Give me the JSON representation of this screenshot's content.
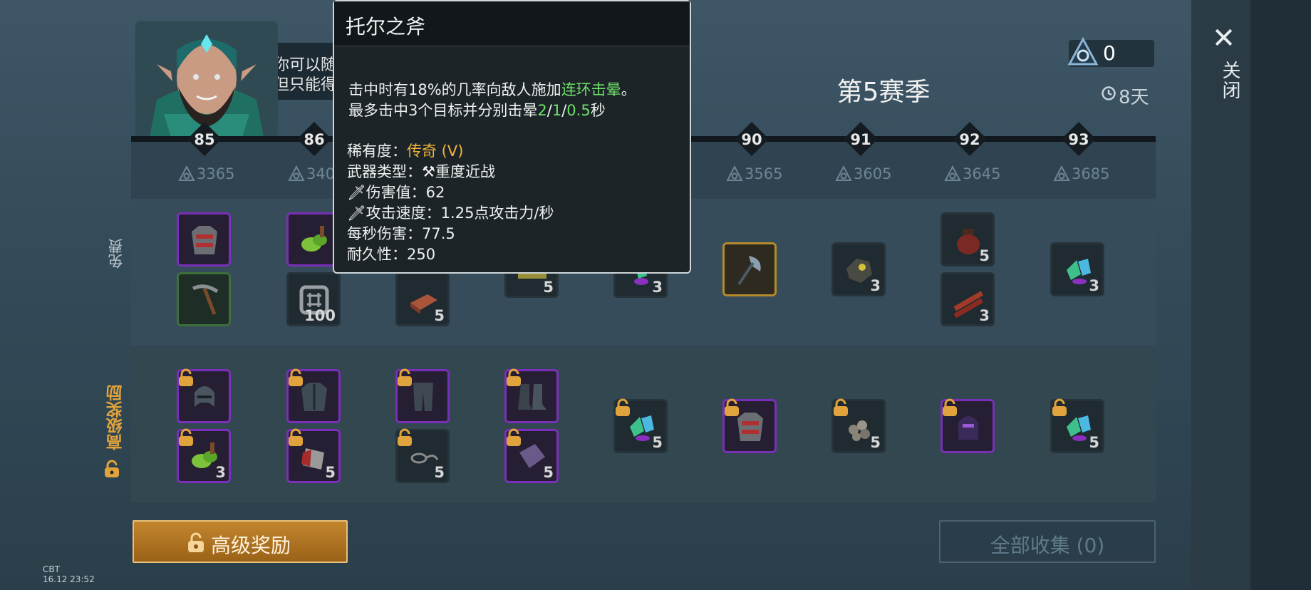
{
  "npc": {
    "speech_line1": "你可以随",
    "speech_line2": "但只能得"
  },
  "close": {
    "icon": "close-icon",
    "label": "关闭"
  },
  "season": {
    "title": "第5赛季",
    "token_count": "0",
    "time_left": "8天"
  },
  "levels": [
    {
      "level": "85",
      "cost": "3365"
    },
    {
      "level": "86",
      "cost": "340"
    },
    {
      "level": "90",
      "cost": "3565"
    },
    {
      "level": "91",
      "cost": "3605"
    },
    {
      "level": "92",
      "cost": "3645"
    },
    {
      "level": "93",
      "cost": "3685"
    }
  ],
  "rows": {
    "free_label": "免费",
    "premium_label": "高级奖励"
  },
  "free_items": [
    {
      "name": "chest-armor-icon",
      "qty": ""
    },
    {
      "name": "pickaxe-icon",
      "qty": ""
    },
    {
      "name": "herb-icon",
      "qty": ""
    },
    {
      "name": "iron-frame-icon",
      "qty": "100"
    },
    {
      "name": "copper-ingot-icon",
      "qty": "5"
    },
    {
      "name": "fiber-icon",
      "qty": "5"
    },
    {
      "name": "crystal-icon",
      "qty": "3"
    },
    {
      "name": "axe-icon",
      "qty": ""
    },
    {
      "name": "ore-icon",
      "qty": "3"
    },
    {
      "name": "pot-icon",
      "qty": "5"
    },
    {
      "name": "wood-planks-icon",
      "qty": "3"
    },
    {
      "name": "crystal-icon",
      "qty": "3"
    }
  ],
  "premium_items": [
    {
      "name": "helmet-icon",
      "qty": ""
    },
    {
      "name": "herb-icon",
      "qty": "3"
    },
    {
      "name": "leather-armor-icon",
      "qty": ""
    },
    {
      "name": "red-cloth-icon",
      "qty": "5"
    },
    {
      "name": "pants-icon",
      "qty": ""
    },
    {
      "name": "rope-icon",
      "qty": "5"
    },
    {
      "name": "boots-icon",
      "qty": ""
    },
    {
      "name": "purple-crystal-icon",
      "qty": "5"
    },
    {
      "name": "crystal-icon",
      "qty": "5"
    },
    {
      "name": "chest-armor-icon",
      "qty": ""
    },
    {
      "name": "stone-pile-icon",
      "qty": "5"
    },
    {
      "name": "purple-helmet-icon",
      "qty": ""
    },
    {
      "name": "crystal-icon",
      "qty": "5"
    }
  ],
  "tooltip": {
    "title": "托尔之斧",
    "desc1_a": "击中时有18%的几率向敌人施加",
    "desc1_b": "连环击晕",
    "desc1_c": "。",
    "desc2_a": "最多击中3个目标并分别击晕",
    "desc2_v1": "2",
    "desc2_s1": "/",
    "desc2_v2": "1",
    "desc2_s2": "/",
    "desc2_v3": "0.5",
    "desc2_b": "秒",
    "rarity_label": "稀有度：",
    "rarity_value": "传奇 (V)",
    "type_label": "武器类型：",
    "type_value": "重度近战",
    "damage_label": "伤害值：",
    "damage_value": "62",
    "speed_label": "攻击速度：",
    "speed_value": "1.25点攻击力/秒",
    "dps_label": "每秒伤害：",
    "dps_value": "77.5",
    "durability_label": "耐久性：",
    "durability_value": "250"
  },
  "buttons": {
    "premium": "高级奖励",
    "collect_all": "全部收集 (0)"
  },
  "build": {
    "line1": "CBT",
    "line2": "16.12 23:52"
  },
  "colors": {
    "legend": "#f2b43a",
    "green": "#6ee06a",
    "epic": "#7a2fb8",
    "premium_btn": "#b67625"
  }
}
